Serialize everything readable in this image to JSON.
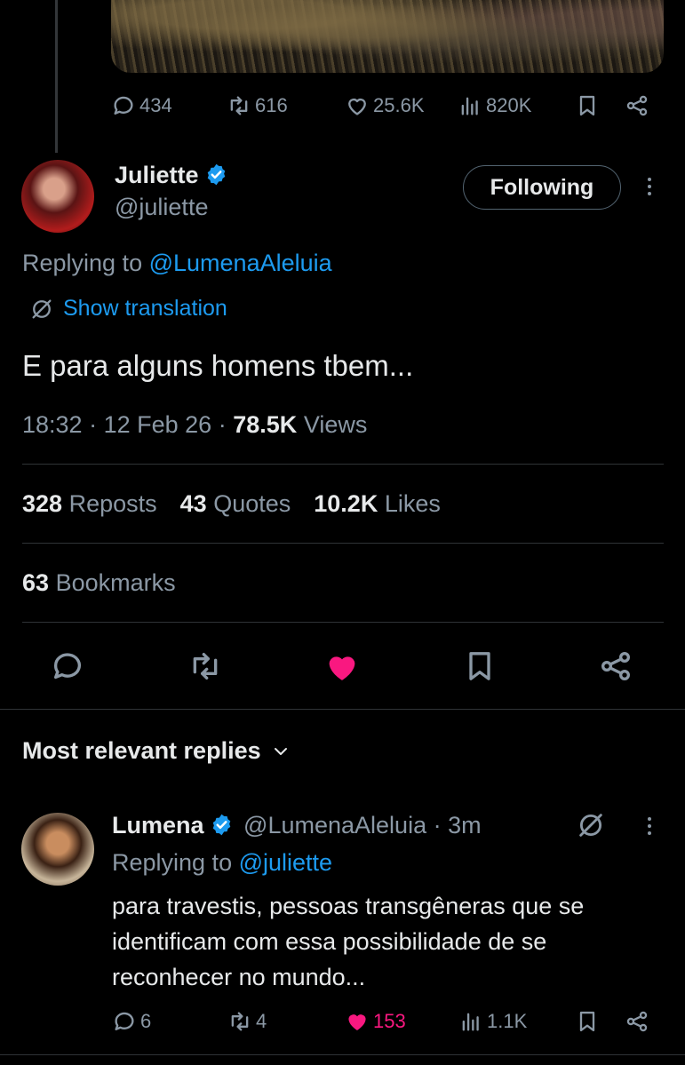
{
  "prev_tweet": {
    "stats": {
      "replies": "434",
      "reposts": "616",
      "likes": "25.6K",
      "views": "820K"
    }
  },
  "tweet": {
    "author_name": "Juliette",
    "author_handle": "@juliette",
    "follow_label": "Following",
    "replying_prefix": "Replying to",
    "replying_to": "@LumenaAleluia",
    "translate_label": "Show translation",
    "text": "E para alguns homens tbem...",
    "time": "18:32",
    "date": "12 Feb 26",
    "views_count": "78.5K",
    "views_label": "Views",
    "reposts_count": "328",
    "reposts_label": "Reposts",
    "quotes_count": "43",
    "quotes_label": "Quotes",
    "likes_count": "10.2K",
    "likes_label": "Likes",
    "bookmarks_count": "63",
    "bookmarks_label": "Bookmarks"
  },
  "replies_section": {
    "sort_label": "Most relevant replies"
  },
  "reply": {
    "author_name": "Lumena",
    "author_handle": "@LumenaAleluia",
    "age": "3m",
    "replying_prefix": "Replying to",
    "replying_to": "@juliette",
    "text_lines": [
      "para travestis, pessoas transgêneras que se",
      "identificam com essa possibilidade de se",
      "reconhecer no mundo..."
    ],
    "stats": {
      "replies": "6",
      "reposts": "4",
      "likes": "153",
      "views": "1.1K"
    }
  },
  "colors": {
    "background": "#000000",
    "text": "#e7e9ea",
    "muted": "#8b98a5",
    "link": "#1d9bf0",
    "like_active": "#f91880",
    "divider": "#2f3336",
    "verified": "#1d9bf0"
  },
  "icons": {
    "reply": "speech-bubble-icon",
    "repost": "repost-arrows-icon",
    "like": "heart-icon",
    "views": "bar-chart-icon",
    "bookmark": "bookmark-icon",
    "share": "share-icon",
    "verified": "verified-badge-icon",
    "translate": "translate-globe-icon",
    "more": "more-vertical-icon",
    "chevron": "chevron-down-icon"
  }
}
